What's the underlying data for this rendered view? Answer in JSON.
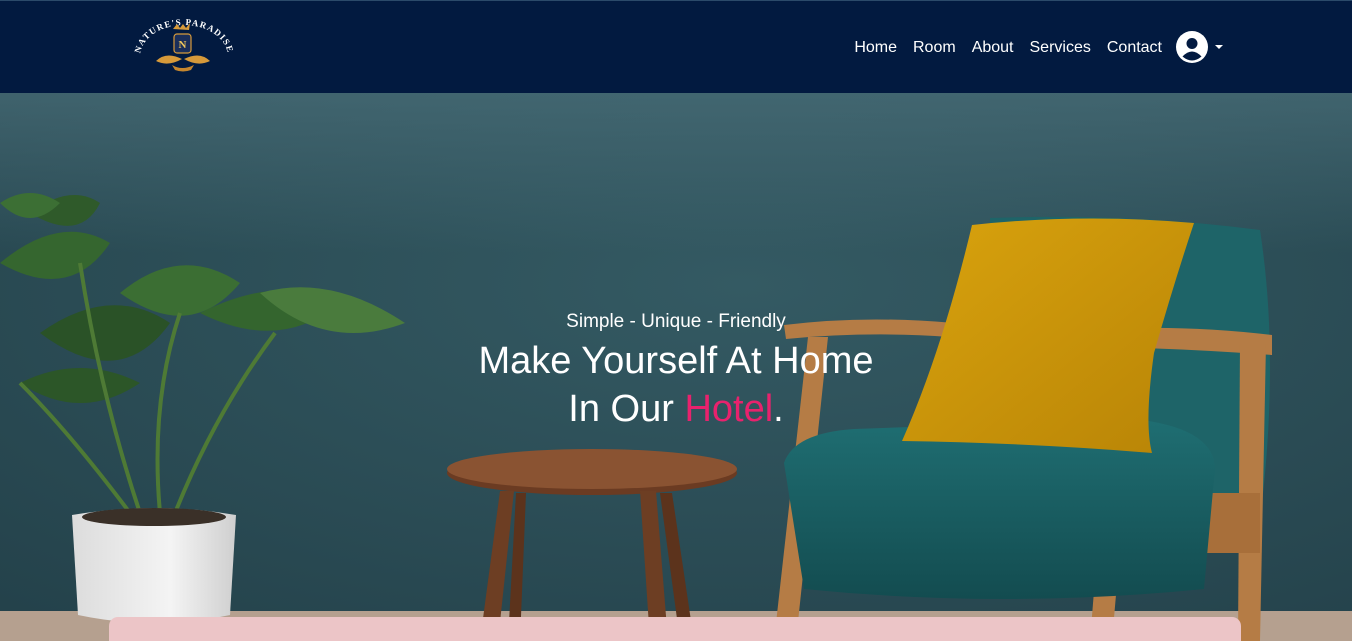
{
  "brand": {
    "logo_text": "NATURE'S PARADISE",
    "logo_initial": "N",
    "icon": "crest-logo"
  },
  "nav": {
    "items": [
      {
        "label": "Home"
      },
      {
        "label": "Room"
      },
      {
        "label": "About"
      },
      {
        "label": "Services"
      },
      {
        "label": "Contact"
      }
    ],
    "user_icon": "user-circle-icon",
    "dropdown_icon": "caret-down-icon"
  },
  "hero": {
    "tagline": "Simple - Unique - Friendly",
    "headline_line1": "Make Yourself At Home",
    "headline_line2_prefix": "In Our ",
    "headline_accent": "Hotel",
    "headline_suffix": "."
  },
  "colors": {
    "navbar": "#021a40",
    "accent": "#e8226d",
    "wall": "#2d4c55",
    "booking_panel": "#ecc5c7"
  }
}
